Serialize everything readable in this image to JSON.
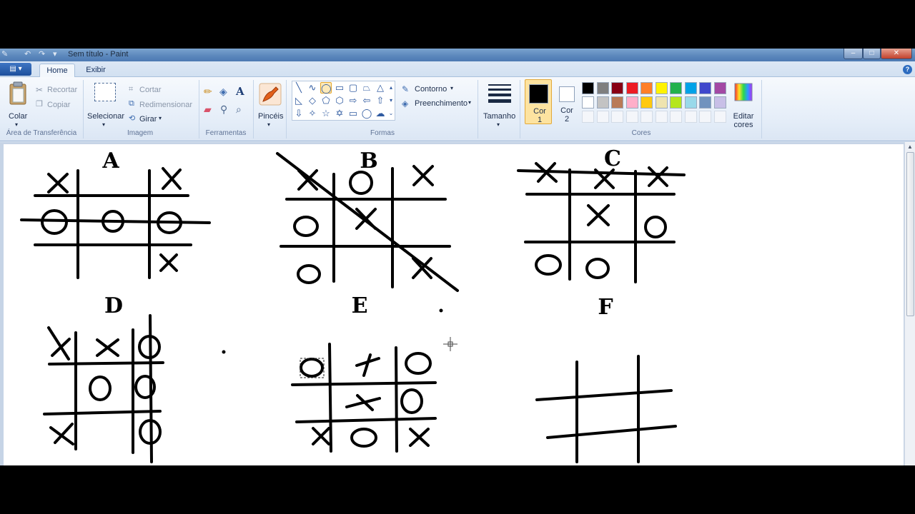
{
  "window": {
    "title": "Sem título - Paint",
    "controls": {
      "minimize": "–",
      "maximize": "□",
      "close": "✕"
    }
  },
  "tabs": [
    {
      "label": "Home",
      "active": true
    },
    {
      "label": "Exibir",
      "active": false
    }
  ],
  "ribbon": {
    "clipboard": {
      "paste": "Colar",
      "cut": "Recortar",
      "copy": "Copiar",
      "group": "Área de Transferência"
    },
    "image": {
      "select": "Selecionar",
      "crop": "Cortar",
      "resize": "Redimensionar",
      "rotate": "Girar",
      "group": "Imagem"
    },
    "tools": {
      "group": "Ferramentas"
    },
    "brushes": {
      "label": "Pincéis"
    },
    "shapes": {
      "outline": "Contorno",
      "fill": "Preenchimento",
      "group": "Formas"
    },
    "size": {
      "label": "Tamanho"
    },
    "colors": {
      "color1": "Cor 1",
      "color2": "Cor 2",
      "edit": "Editar cores",
      "group": "Cores",
      "color1_value": "#000000",
      "color2_value": "#ffffff",
      "palette_row1": [
        "#000000",
        "#7f7f7f",
        "#880015",
        "#ed1c24",
        "#ff7f27",
        "#fff200",
        "#22b14c",
        "#00a2e8",
        "#3f48cc",
        "#a349a4"
      ],
      "palette_row2": [
        "#ffffff",
        "#c3c3c3",
        "#b97a57",
        "#ffaec9",
        "#ffc90e",
        "#efe4b0",
        "#b5e61d",
        "#99d9ea",
        "#7092be",
        "#c8bfe7"
      ]
    }
  },
  "canvas": {
    "boards": [
      {
        "label": "A",
        "marks": [
          "X",
          "X",
          "O",
          "O",
          "O",
          "X"
        ]
      },
      {
        "label": "B",
        "marks": [
          "X",
          "O",
          "X",
          "O",
          "X",
          "O",
          "X"
        ]
      },
      {
        "label": "C",
        "marks": [
          "X",
          "X",
          "X",
          "X",
          "O",
          "O",
          "O"
        ]
      },
      {
        "label": "D",
        "marks": [
          "X",
          "X",
          "O",
          "O",
          "O",
          "X",
          "O"
        ]
      },
      {
        "label": "E",
        "marks": [
          "O",
          "X",
          "O",
          "X",
          "O",
          "X",
          "O",
          "X"
        ]
      },
      {
        "label": "F",
        "marks": []
      }
    ]
  }
}
